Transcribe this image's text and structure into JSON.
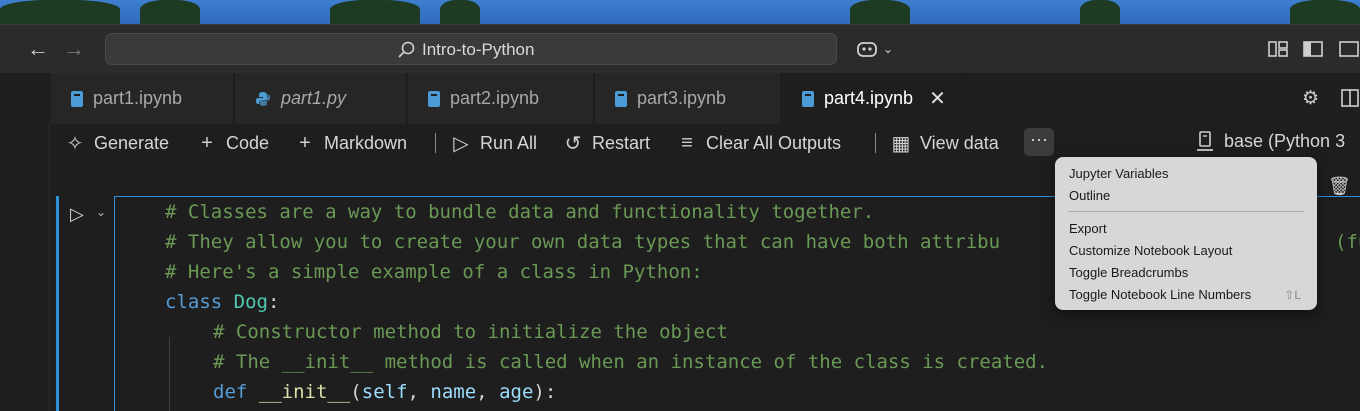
{
  "titlebar": {
    "back_icon": "arrow-left-icon",
    "forward_icon": "arrow-right-icon",
    "search_label": "Intro-to-Python",
    "copilot_icon": "copilot-icon"
  },
  "tabs": [
    {
      "label": "part1.ipynb",
      "icon": "notebook-icon",
      "italic": false,
      "active": false
    },
    {
      "label": "part1.py",
      "icon": "python-icon",
      "italic": true,
      "active": false
    },
    {
      "label": "part2.ipynb",
      "icon": "notebook-icon",
      "italic": false,
      "active": false
    },
    {
      "label": "part3.ipynb",
      "icon": "notebook-icon",
      "italic": false,
      "active": false
    },
    {
      "label": "part4.ipynb",
      "icon": "notebook-icon",
      "italic": false,
      "active": true
    }
  ],
  "toolbar": {
    "generate": "Generate",
    "code": "Code",
    "markdown": "Markdown",
    "run_all": "Run All",
    "restart": "Restart",
    "clear_outputs": "Clear All Outputs",
    "view_data": "View data",
    "more": "···",
    "kernel": "base (Python 3"
  },
  "code": {
    "line1": "# Classes are a way to bundle data and functionality together.",
    "line2": "# They allow you to create your own data types that can have both attribu",
    "line2_tail": "(fu",
    "line3": "# Here's a simple example of a class in Python:",
    "line4_kw": "class",
    "line4_name": "Dog",
    "line4_colon": ":",
    "line5": "# Constructor method to initialize the object",
    "line6": "# The __init__ method is called when an instance of the class is created.",
    "line7_kw": "def",
    "line7_name": "__init__",
    "line7_open": "(",
    "line7_self": "self",
    "line7_sep1": ", ",
    "line7_name_param": "name",
    "line7_sep2": ", ",
    "line7_age": "age",
    "line7_close": "):"
  },
  "menu": {
    "items_group1": [
      "Jupyter Variables",
      "Outline"
    ],
    "items_group2": [
      "Export",
      "Customize Notebook Layout",
      "Toggle Breadcrumbs",
      "Toggle Notebook Line Numbers"
    ],
    "toggle_line_numbers_shortcut": "⇧L"
  },
  "colors": {
    "accent": "#2f8fd8",
    "comment": "#6a9955",
    "keyword": "#569cd6",
    "class_name": "#4ec9b0"
  }
}
